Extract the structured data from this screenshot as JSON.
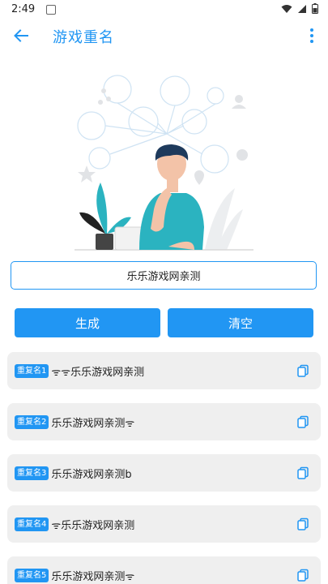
{
  "status_bar": {
    "time": "2:49"
  },
  "app_bar": {
    "title": "游戏重名"
  },
  "name_input": {
    "value": "乐乐游戏网亲测"
  },
  "buttons": {
    "generate": "生成",
    "clear": "清空"
  },
  "results": [
    {
      "badge": "重复名1",
      "text": "ᯤᯤ乐乐游戏网亲测"
    },
    {
      "badge": "重复名2",
      "text": "乐乐游戏网亲测ᯤ"
    },
    {
      "badge": "重复名3",
      "text": "乐乐游戏网亲测b"
    },
    {
      "badge": "重复名4",
      "text": "ᯤ乐乐游戏网亲测"
    },
    {
      "badge": "重复名5",
      "text": "乐乐游戏网亲测ᯤ"
    }
  ],
  "colors": {
    "accent": "#2196F3",
    "row_bg": "#efefef",
    "illustration_teal": "#2bb3c0"
  },
  "icons": [
    "back-arrow-icon",
    "more-vert-icon",
    "copy-icon",
    "wifi-icon",
    "signal-icon",
    "battery-icon"
  ]
}
